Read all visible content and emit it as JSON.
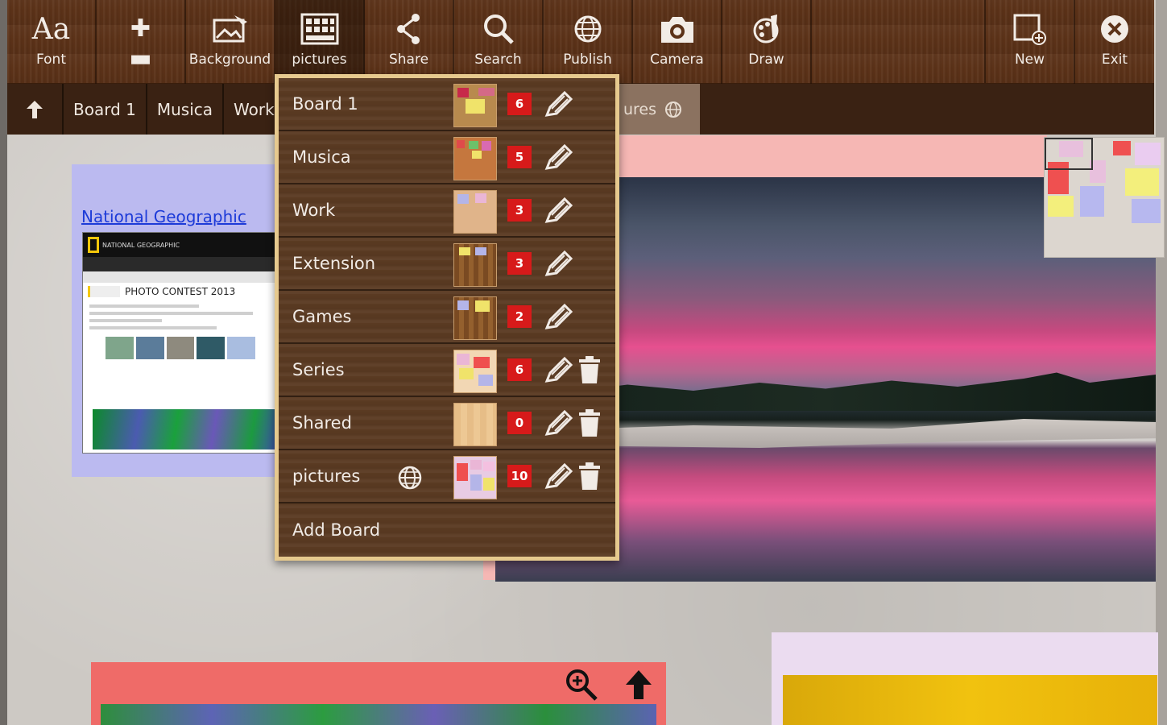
{
  "toolbar": {
    "font": "Font",
    "font_glyph": "Aa",
    "zoom": "",
    "background": "Background",
    "pictures": "pictures",
    "share": "Share",
    "search": "Search",
    "publish": "Publish",
    "camera": "Camera",
    "draw": "Draw",
    "new": "New",
    "exit": "Exit"
  },
  "breadcrumbs": [
    "Board 1",
    "Musica",
    "Work"
  ],
  "breadcrumb_tail": "ures",
  "board_menu": {
    "items": [
      {
        "label": "Board 1",
        "count": "6",
        "deletable": false
      },
      {
        "label": "Musica",
        "count": "5",
        "deletable": false
      },
      {
        "label": "Work",
        "count": "3",
        "deletable": false
      },
      {
        "label": "Extension",
        "count": "3",
        "deletable": false
      },
      {
        "label": "Games",
        "count": "2",
        "deletable": false
      },
      {
        "label": "Series",
        "count": "6",
        "deletable": true
      },
      {
        "label": "Shared",
        "count": "0",
        "deletable": true
      },
      {
        "label": "pictures",
        "count": "10",
        "deletable": true,
        "published": true
      }
    ],
    "add_label": "Add Board"
  },
  "notes": {
    "ng_link": "National Geographic",
    "ng_page": {
      "brand": "NATIONAL GEOGRAPHIC",
      "title": "PHOTO CONTEST 2013"
    }
  },
  "colors": {
    "wood": "#5c3218",
    "menu_border": "#e6c98e",
    "count_badge": "#d71a1a",
    "link": "#1d3bd8"
  }
}
